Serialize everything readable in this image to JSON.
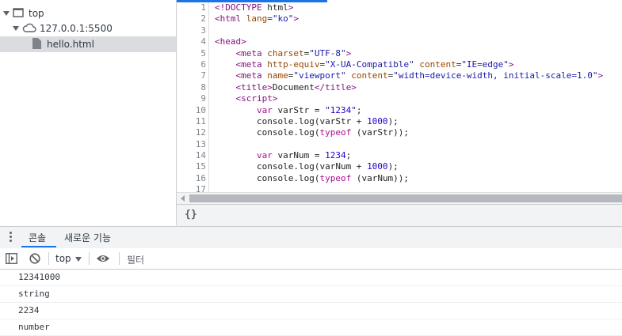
{
  "navigator": {
    "items": [
      {
        "label": "top"
      },
      {
        "label": "127.0.0.1:5500"
      },
      {
        "label": "hello.html"
      }
    ]
  },
  "editor": {
    "line_numbers": [
      "1",
      "2",
      "3",
      "4",
      "5",
      "6",
      "7",
      "8",
      "9",
      "10",
      "11",
      "12",
      "13",
      "14",
      "15",
      "16",
      "17"
    ],
    "lines": [
      "<!DOCTYPE html>",
      "<html lang=\"ko\">",
      "",
      "<head>",
      "    <meta charset=\"UTF-8\">",
      "    <meta http-equiv=\"X-UA-Compatible\" content=\"IE=edge\">",
      "    <meta name=\"viewport\" content=\"width=device-width, initial-scale=1.0\">",
      "    <title>Document</title>",
      "    <script>",
      "        var varStr = \"1234\";",
      "        console.log(varStr + 1000);",
      "        console.log(typeof (varStr));",
      "",
      "        var varNum = 1234;",
      "        console.log(varNum + 1000);",
      "        console.log(typeof (varNum));",
      ""
    ],
    "footer_icon_label": "{}"
  },
  "drawer": {
    "tabs": [
      {
        "label": "콘솔"
      },
      {
        "label": "새로운 기능"
      }
    ]
  },
  "console": {
    "context": "top",
    "filter_placeholder": "필터",
    "messages": [
      "12341000",
      "string",
      "2234",
      "number"
    ]
  },
  "colors": {
    "accent": "#1a73e8",
    "selected_row": "#dadcdf",
    "panel_bg": "#f1f3f4"
  }
}
